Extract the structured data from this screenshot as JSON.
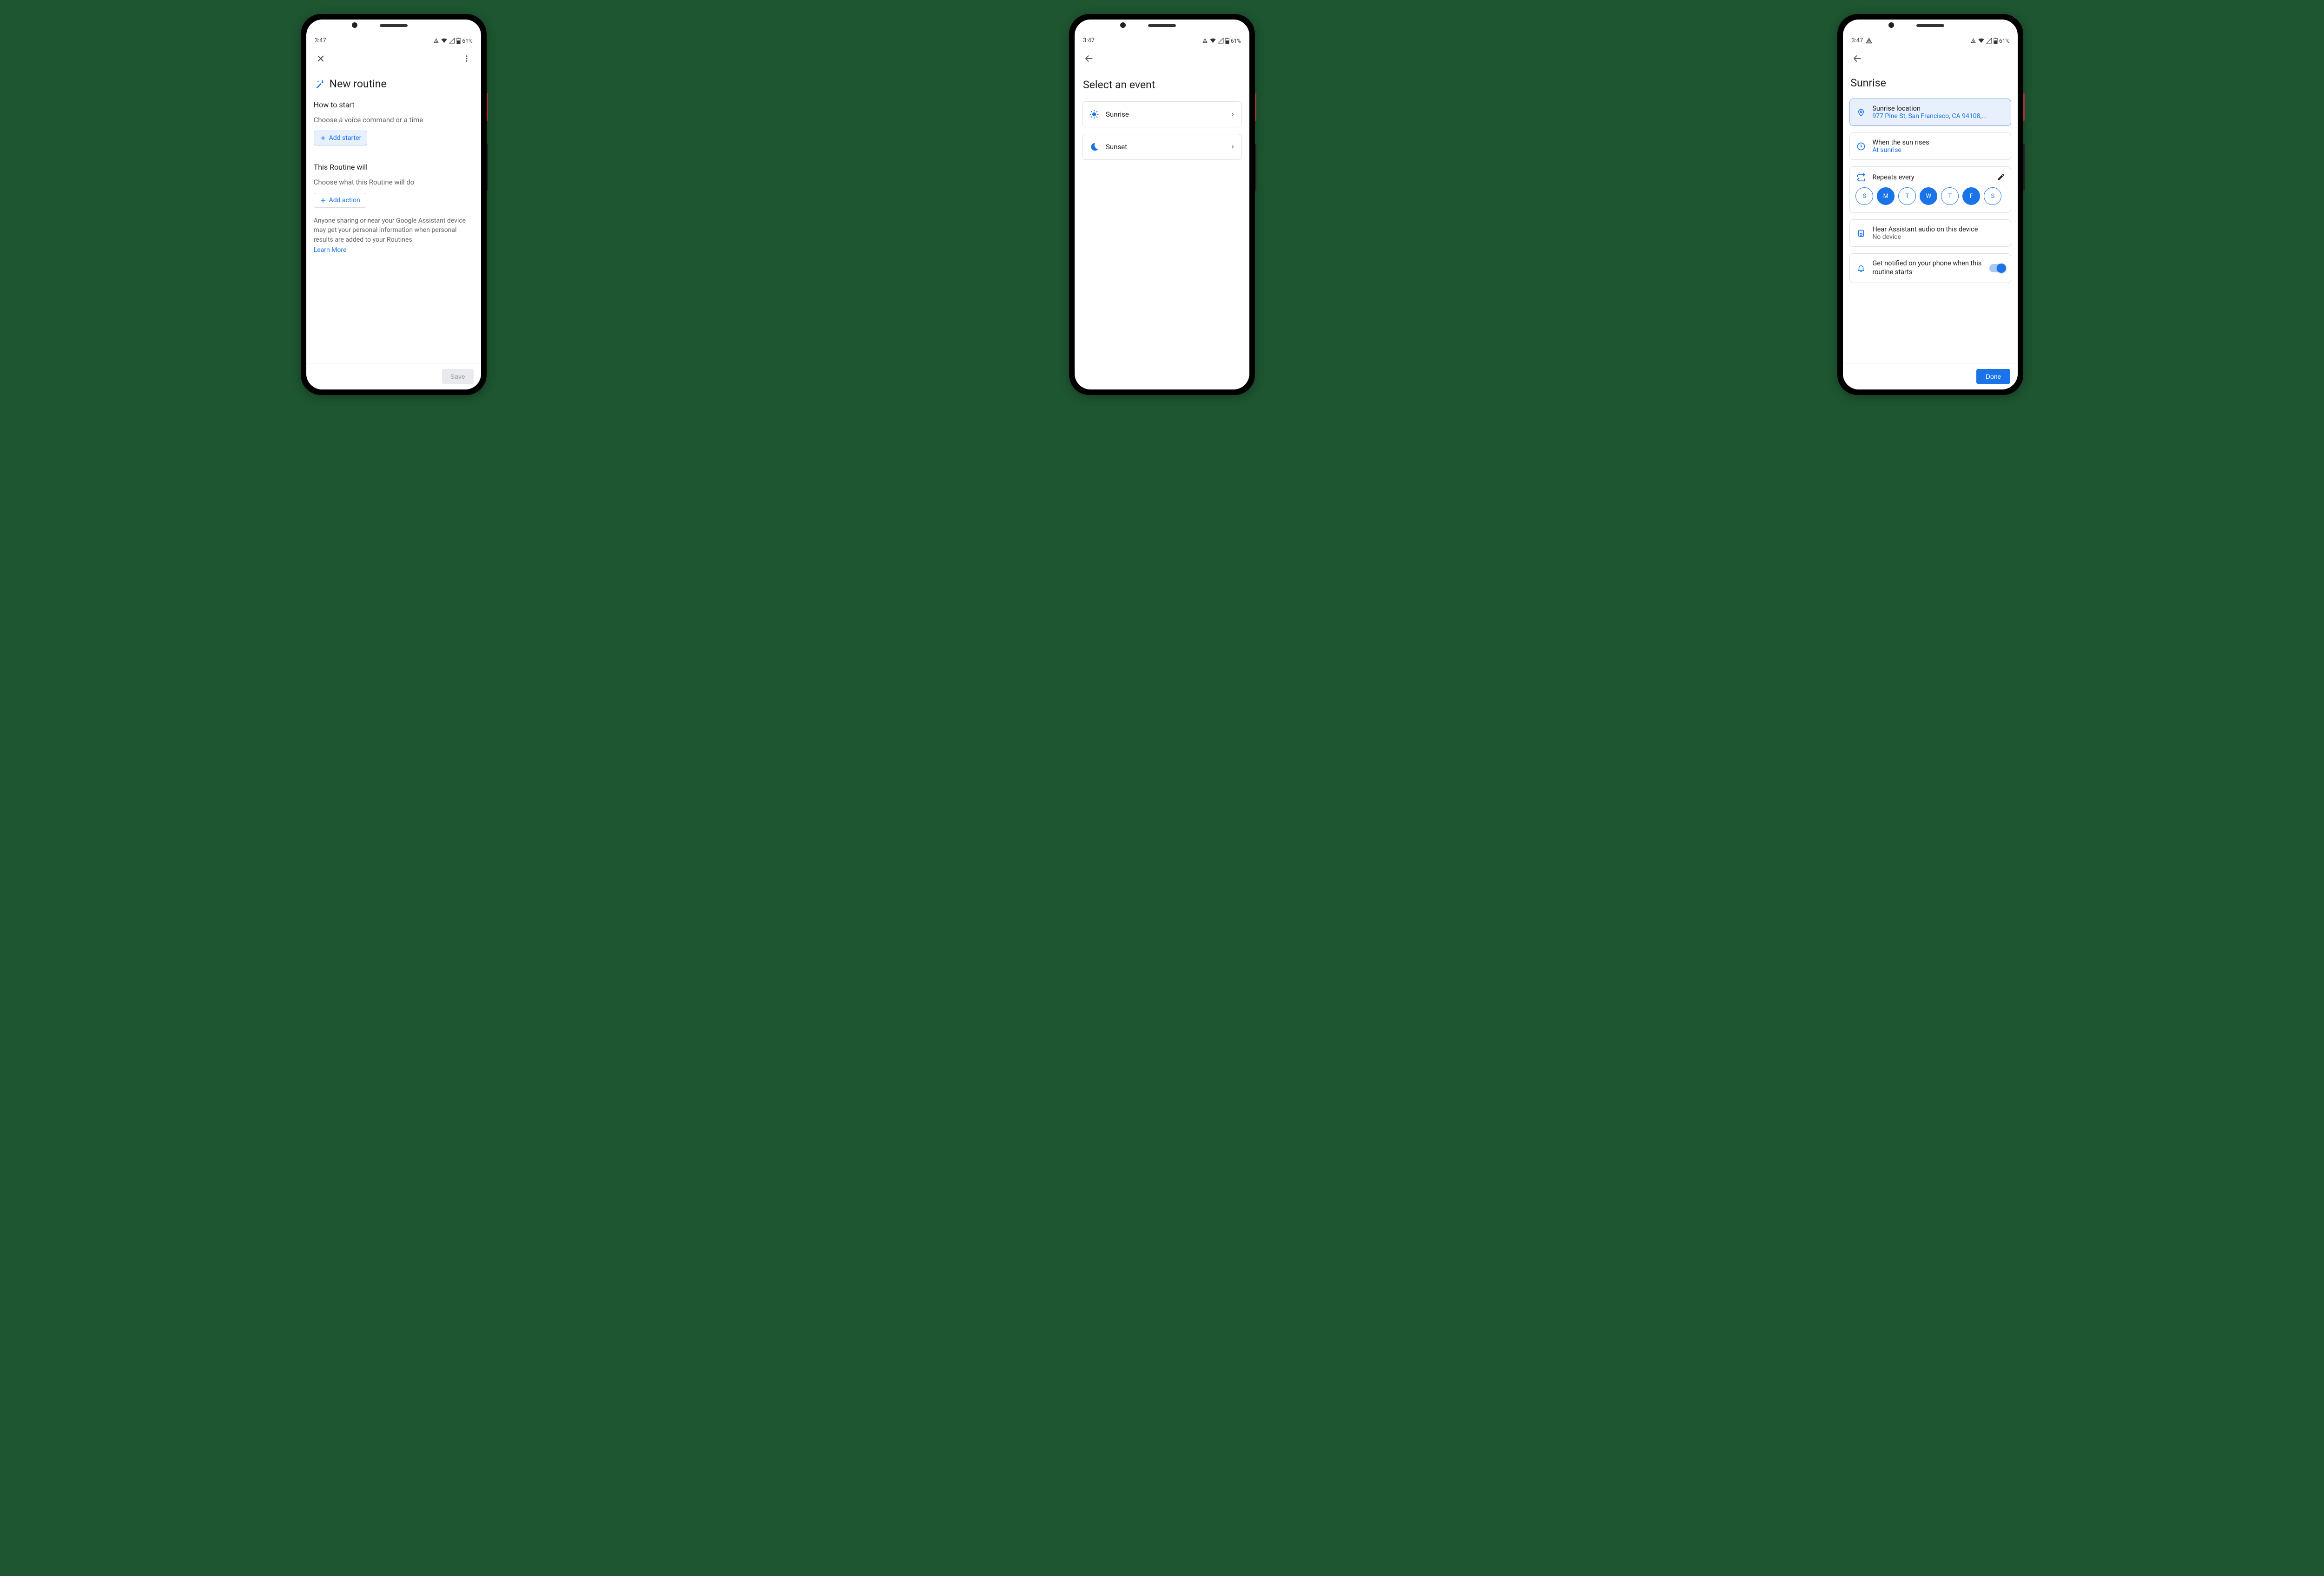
{
  "status": {
    "time": "3:47",
    "battery": "61%"
  },
  "screen1": {
    "title": "New routine",
    "howToStart": "How to start",
    "howToStartHint": "Choose a voice command or a time",
    "addStarter": "Add starter",
    "thisRoutineWill": "This Routine will",
    "thisRoutineWillHint": "Choose what this Routine will do",
    "addAction": "Add action",
    "info": "Anyone sharing or near your Google Assistant device may get your personal information when personal results are added to your Routines.",
    "learnMore": "Learn More",
    "save": "Save"
  },
  "screen2": {
    "title": "Select an event",
    "options": [
      {
        "label": "Sunrise",
        "icon": "sun"
      },
      {
        "label": "Sunset",
        "icon": "moon"
      }
    ]
  },
  "screen3": {
    "title": "Sunrise",
    "location": {
      "title": "Sunrise location",
      "sub": "977 Pine St, San Francisco, CA 94108,..."
    },
    "when": {
      "title": "When the sun rises",
      "sub": "At sunrise"
    },
    "repeats": {
      "title": "Repeats every",
      "days": [
        {
          "label": "S",
          "on": false
        },
        {
          "label": "M",
          "on": true
        },
        {
          "label": "T",
          "on": false
        },
        {
          "label": "W",
          "on": true
        },
        {
          "label": "T",
          "on": false
        },
        {
          "label": "F",
          "on": true
        },
        {
          "label": "S",
          "on": false
        }
      ]
    },
    "audio": {
      "title": "Hear Assistant audio on this device",
      "sub": "No device"
    },
    "notify": {
      "title": "Get notified on your phone when this routine starts",
      "on": true
    },
    "done": "Done"
  }
}
